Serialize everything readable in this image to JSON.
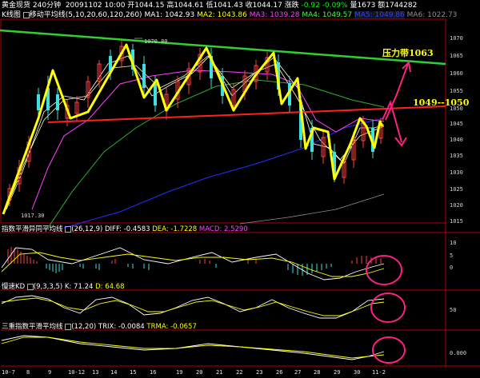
{
  "header": {
    "symbol": "黄金现货",
    "period": "240分钟",
    "date": "20091102 10:00",
    "open": "开1044.15",
    "high": "高1044.61",
    "low": "低1041.43",
    "close": "收1044.17",
    "change_label": "涨跌",
    "change": "-0.92",
    "change_pct": "-0.09%",
    "volume": "量1673",
    "amount": "额1744282"
  },
  "ma_bar": {
    "label": "K线图",
    "name": "移动平均线",
    "params": "(5,10,20,60,120,260)",
    "ma1": "MA1: 1042.93",
    "ma2": "MA2: 1043.86",
    "ma3": "MA3: 1039.28",
    "ma4": "MA4: 1049.57",
    "ma5": "MA5: 1049.86",
    "ma6": "MA6: 1022.73"
  },
  "price_axis": [
    "1070",
    "1065",
    "1060",
    "1055",
    "1050",
    "1045",
    "1040",
    "1035",
    "1030",
    "1025",
    "1020",
    "1015"
  ],
  "annotations": {
    "peak": "1070.80",
    "trough": "1017.30",
    "pressure": "压力带1063",
    "zone": "1049--1050"
  },
  "macd": {
    "title": "指数平滑异同平均线",
    "params": "(26,12,9)",
    "diff": "DIFF: -0.4583",
    "dea": "DEA: -1.7228",
    "macd": "MACD: 2.5290",
    "axis": [
      "10",
      "5",
      "0"
    ]
  },
  "kd": {
    "title": "慢速KD",
    "params": "(9,3,3,5)",
    "k": "K: 71.24",
    "d": "D: 64.68",
    "axis": [
      "50"
    ]
  },
  "trix": {
    "title": "三重指数平滑平均线",
    "params": "(12,20)",
    "trix": "TRIX: -0.0084",
    "trma": "TRMA: -0.0657",
    "axis": [
      "0.000"
    ]
  },
  "date_axis": [
    "10-7",
    "8",
    "9",
    "10-12",
    "13",
    "14",
    "15",
    "16",
    "19",
    "20",
    "21",
    "22",
    "23",
    "26",
    "27",
    "28",
    "29",
    "30",
    "11-2"
  ],
  "colors": {
    "yellow_lines": "#ffff00",
    "red_line": "#ff2020",
    "green_line": "#30d030",
    "arrows": "#ff2080",
    "bull_candle": "#ff4040",
    "bear_candle": "#40e0e0"
  }
}
